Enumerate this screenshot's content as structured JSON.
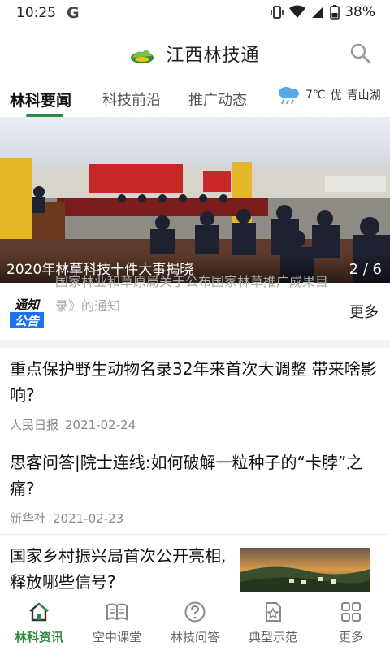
{
  "status": {
    "time": "10:25",
    "carrier_glyph": "G",
    "battery": "38%"
  },
  "app": {
    "title": "江西林技通"
  },
  "tabs": [
    {
      "label": "林科要闻",
      "active": true
    },
    {
      "label": "科技前沿",
      "active": false
    },
    {
      "label": "推广动态",
      "active": false
    }
  ],
  "weather": {
    "temp": "7℃",
    "quality": "优",
    "location": "青山湖"
  },
  "banner": {
    "caption": "2020年林草科技十件大事揭晓",
    "index": "2 / 6"
  },
  "notice": {
    "badge_top": "通知",
    "badge_bottom": "公告",
    "text": "国家林业和草原局关于公布国家林草推广成果目录》的通知",
    "more": "更多"
  },
  "articles": [
    {
      "title": "重点保护野生动物名录32年来首次大调整 带来啥影响?",
      "source": "人民日报",
      "date": "2021-02-24"
    },
    {
      "title": "思客问答|院士连线:如何破解一粒种子的“卡脖”之痛?",
      "source": "新华社",
      "date": "2021-02-23"
    },
    {
      "title": "国家乡村振兴局首次公开亮相,释放哪些信号?",
      "source": "",
      "date": ""
    }
  ],
  "bottom_nav": [
    {
      "label": "林科资讯",
      "icon": "home-icon",
      "active": true
    },
    {
      "label": "空中课堂",
      "icon": "book-icon",
      "active": false
    },
    {
      "label": "林技问答",
      "icon": "question-icon",
      "active": false
    },
    {
      "label": "典型示范",
      "icon": "star-doc-icon",
      "active": false
    },
    {
      "label": "更多",
      "icon": "grid-icon",
      "active": false
    }
  ],
  "colors": {
    "accent": "#2e8b3d",
    "notice_blue": "#1a73e8"
  }
}
